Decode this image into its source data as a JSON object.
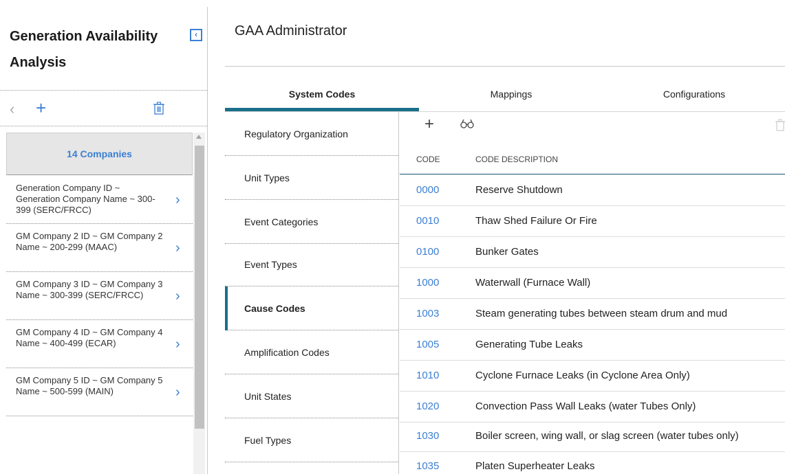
{
  "app": {
    "title": "Generation Availability Analysis",
    "collapse_icon": "chevron-left-icon"
  },
  "left_toolbar": {
    "back_icon": "chevron-left-icon",
    "add_icon": "plus-icon",
    "delete_icon": "trash-icon"
  },
  "companies": {
    "header": "14 Companies",
    "items": [
      {
        "label": "Generation Company ID ~ Generation Company Name ~ 300-399 (SERC/FRCC)"
      },
      {
        "label": "GM Company 2 ID ~ GM Company 2 Name ~ 200-299 (MAAC)"
      },
      {
        "label": "GM Company 3 ID ~ GM Company 3 Name ~ 300-399 (SERC/FRCC)"
      },
      {
        "label": "GM Company 4 ID ~ GM Company 4 Name ~ 400-499 (ECAR)"
      },
      {
        "label": "GM Company 5 ID ~ GM Company 5 Name ~ 500-599 (MAIN)"
      }
    ]
  },
  "main": {
    "title": "GAA Administrator",
    "tabs": [
      {
        "label": "System Codes",
        "active": true
      },
      {
        "label": "Mappings",
        "active": false
      },
      {
        "label": "Configurations",
        "active": false
      }
    ],
    "subnav": [
      {
        "label": "Regulatory Organization",
        "active": false
      },
      {
        "label": "Unit Types",
        "active": false
      },
      {
        "label": "Event Categories",
        "active": false
      },
      {
        "label": "Event Types",
        "active": false
      },
      {
        "label": "Cause Codes",
        "active": true
      },
      {
        "label": "Amplification Codes",
        "active": false
      },
      {
        "label": "Unit States",
        "active": false
      },
      {
        "label": "Fuel Types",
        "active": false
      }
    ],
    "grid": {
      "toolbar": {
        "add_icon": "plus-icon",
        "find_icon": "binoculars-icon",
        "delete_icon": "trash-icon"
      },
      "columns": [
        "CODE",
        "CODE DESCRIPTION"
      ],
      "rows": [
        {
          "code": "0000",
          "description": "Reserve Shutdown"
        },
        {
          "code": "0010",
          "description": "Thaw Shed Failure Or Fire"
        },
        {
          "code": "0100",
          "description": "Bunker Gates"
        },
        {
          "code": "1000",
          "description": "Waterwall (Furnace Wall)"
        },
        {
          "code": "1003",
          "description": "Steam generating tubes between steam drum and mud"
        },
        {
          "code": "1005",
          "description": "Generating Tube Leaks"
        },
        {
          "code": "1010",
          "description": "Cyclone Furnace Leaks (in Cyclone Area Only)"
        },
        {
          "code": "1020",
          "description": "Convection Pass Wall Leaks (water Tubes Only)"
        },
        {
          "code": "1030",
          "description": "Boiler screen, wing wall, or slag screen (water tubes only)"
        },
        {
          "code": "1035",
          "description": "Platen Superheater Leaks"
        }
      ]
    }
  },
  "colors": {
    "accent": "#3b7fd4",
    "tab_underline": "#1b6f8a"
  }
}
